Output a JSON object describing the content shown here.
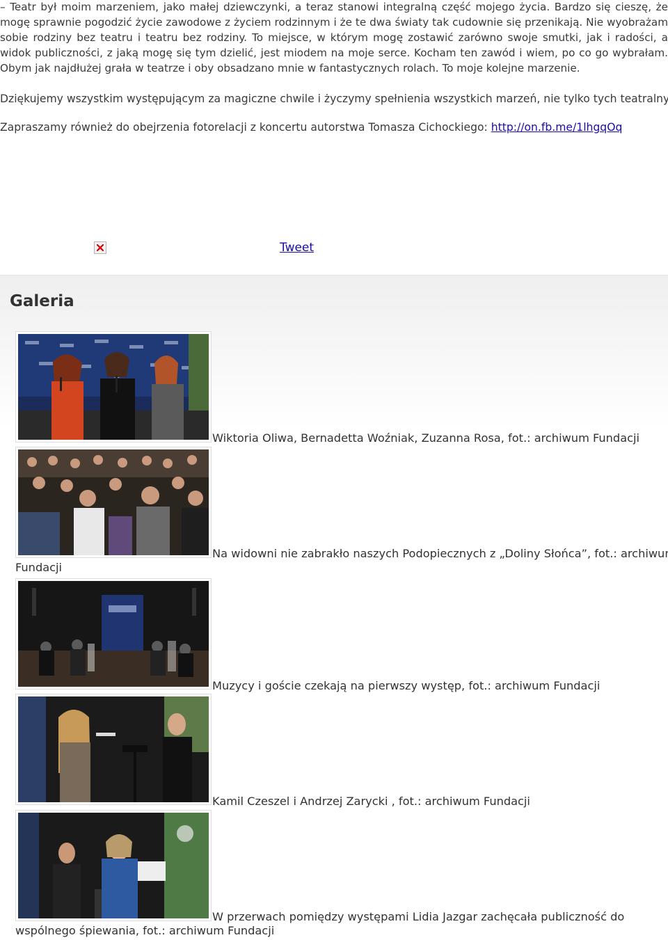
{
  "article": {
    "paragraph_1": "– Teatr był moim marzeniem, jako małej dziewczynki, a teraz stanowi integralną część mojego życia. Bardzo się cieszę, że mogę sprawnie pogodzić życie zawodowe z życiem rodzinnym i że te dwa światy tak cudownie się przenikają. Nie wyobrażam sobie rodziny bez teatru i teatru bez rodziny. To miejsce, w którym mogę zostawić zarówno swoje smutki, jak i radości, a widok publiczności, z jaką mogę się tym dzielić, jest miodem na moje serce. Kocham ten zawód i wiem, po co go wybrałam. Obym jak najdłużej grała w teatrze i oby obsadzano mnie w fantastycznych rolach. To moje kolejne marzenie.",
    "paragraph_2": "Dziękujemy wszystkim występującym za magiczne chwile i życzymy spełnienia wszystkich marzeń, nie tylko tych teatralnych.",
    "paragraph_3_text": "Zapraszamy również do obejrzenia fotorelacji z koncertu autorstwa Tomasza Cichockiego: ",
    "paragraph_3_link": "http://on.fb.me/1lhgqOq"
  },
  "share": {
    "broken_image_icon": "broken-image-icon",
    "tweet_label": "Tweet"
  },
  "gallery": {
    "title": "Galeria",
    "items": [
      {
        "caption": "Wiktoria Oliwa, Bernadetta Woźniak, Zuzanna Rosa, fot.: archiwum Fundacji"
      },
      {
        "caption_line1": "Na widowni nie zabrakło naszych Podopiecznych z „Doliny Słońca”, fot.: archiwum",
        "caption_line2": "Fundacji"
      },
      {
        "caption": "Muzycy i goście czekają na pierwszy występ, fot.: archiwum Fundacji"
      },
      {
        "caption": "Kamil Czeszel i Andrzej Zarycki , fot.: archiwum Fundacji"
      },
      {
        "caption_line1": "W przerwach pomiędzy występami Lidia Jazgar zachęcała publiczność do",
        "caption_line2": "wspólnego śpiewania, fot.: archiwum Fundacji"
      }
    ]
  }
}
